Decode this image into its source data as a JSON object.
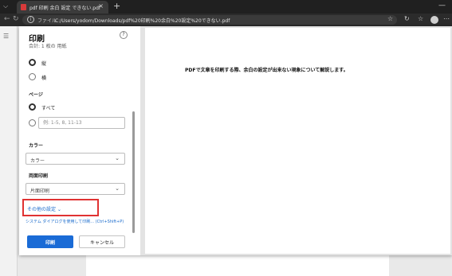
{
  "browser": {
    "tab_title": "pdf 印刷 余白 設定 できない.pdf",
    "tab_close_glyph": "×",
    "new_tab_glyph": "+",
    "minimize_glyph": "—",
    "url_scheme": "ファイル",
    "url": "C:/Users/yodom/Downloads/pdf%20印刷%20余白%20設定%20できない.pdf"
  },
  "print_panel": {
    "title": "印刷",
    "subtitle": "合計: 1 枚の 用紙",
    "help_glyph": "?",
    "orientation": {
      "options": [
        {
          "label": "縦",
          "checked": true
        },
        {
          "label": "横",
          "checked": false
        }
      ]
    },
    "pages": {
      "label": "ページ",
      "options": [
        {
          "label": "すべて",
          "checked": true
        }
      ],
      "custom_placeholder": "例: 1-5, 8, 11-13"
    },
    "color": {
      "label": "カラー",
      "value": "カラー"
    },
    "duplex": {
      "label": "両面印刷",
      "value": "片面印刷"
    },
    "more_settings_label": "その他の設定 ⌄",
    "system_dialog_link": "システム ダイアログを使用して印刷... (Ctrl+Shift+P)",
    "print_button": "印刷",
    "cancel_button": "キャンセル"
  },
  "preview": {
    "page_text": "PDFで文章を印刷する際、余白の設定が出来ない現象について解説します。"
  },
  "colors": {
    "accent": "#1a6bd6",
    "highlight_box": "#e03232",
    "link": "#1a6bcc"
  },
  "icons": [
    "chevron-down-icon",
    "pdf-icon",
    "close-icon",
    "plus-icon",
    "back-icon",
    "forward-icon",
    "info-icon",
    "favorite-icon",
    "refresh-icon",
    "collections-icon",
    "profile-icon",
    "menu-icon",
    "help-icon"
  ]
}
